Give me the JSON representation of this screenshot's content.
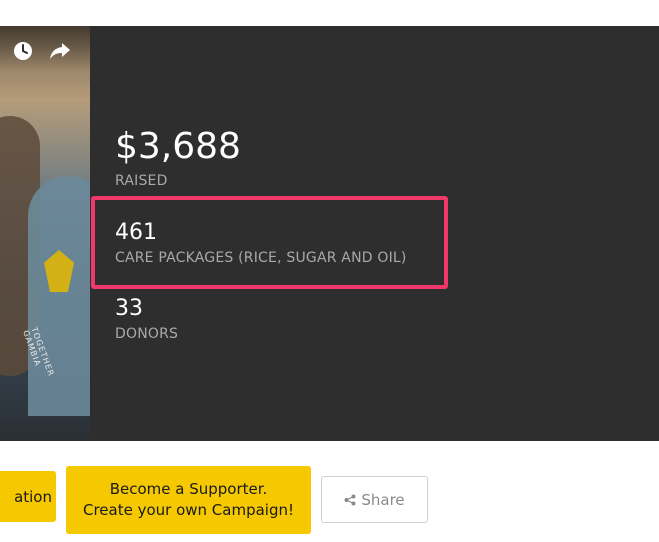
{
  "video": {
    "thumbnail_text": "TOGETHER GAMBIA",
    "icons": [
      "clock-icon",
      "share-arrow-icon"
    ]
  },
  "stats": {
    "raised": {
      "value": "$3,688",
      "label": "RAISED"
    },
    "packages": {
      "value": "461",
      "label": "CARE PACKAGES (RICE, SUGAR AND OIL)"
    },
    "donors": {
      "value": "33",
      "label": "DONORS"
    }
  },
  "buttons": {
    "donation_label": "ation",
    "supporter_line1": "Become a Supporter.",
    "supporter_line2": "Create your own Campaign!",
    "share_label": "Share",
    "share_icon": "share-nodes-icon"
  },
  "colors": {
    "panel": "#2e2e2e",
    "accent_yellow": "#f5c800",
    "highlight": "#f0386b",
    "label_gray": "#a9a9a9"
  }
}
